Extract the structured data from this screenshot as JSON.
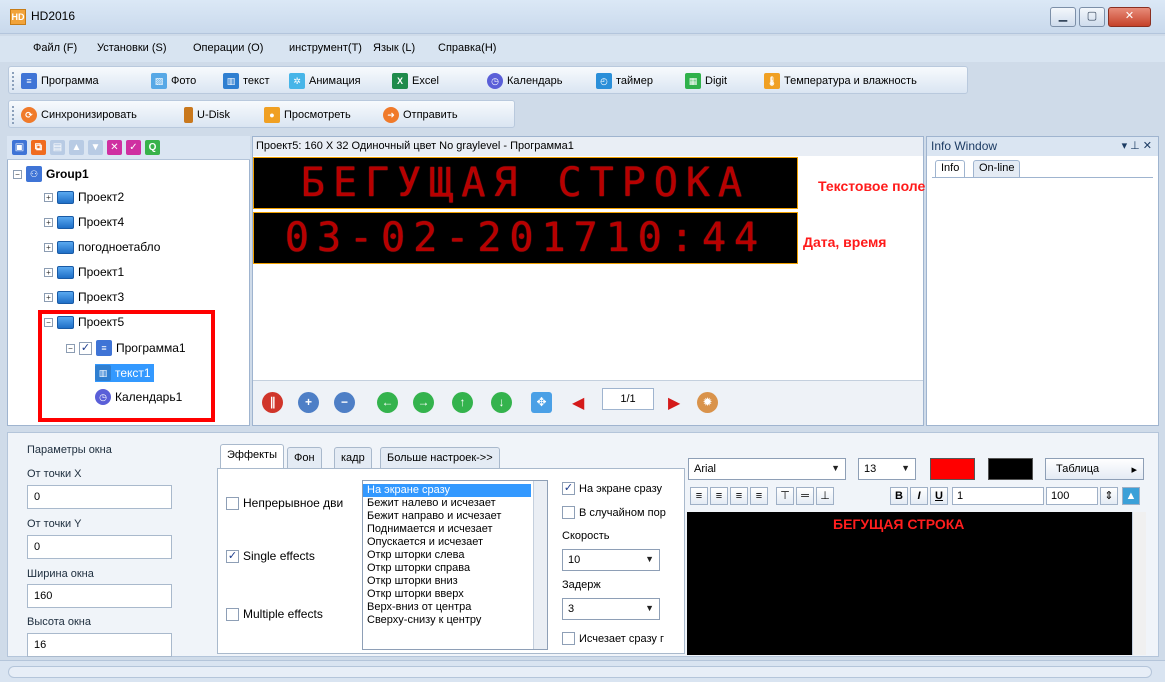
{
  "window": {
    "title": "HD2016",
    "app_icon": "HD"
  },
  "menu": [
    "Файл (F)",
    "Установки (S)",
    "Операции (O)",
    "инструмент(T)",
    "Язык (L)",
    "Справка(H)"
  ],
  "toolbar1": [
    "Программа",
    "Фото",
    "текст",
    "Анимация",
    "Excel",
    "Календарь",
    "таймер",
    "Digit",
    "Температура и влажность"
  ],
  "toolbar2": [
    "Синхронизировать",
    "U-Disk",
    "Просмотреть",
    "Отправить"
  ],
  "tree": {
    "group": "Group1",
    "projects": [
      "Проект2",
      "Проект4",
      "погодноетабло",
      "Проект1",
      "Проект3",
      "Проект5"
    ],
    "program": "Программа1",
    "text_item": "текст1",
    "calendar_item": "Календарь1"
  },
  "preview": {
    "header": "Проект5: 160 X 32  Одиночный цвет No graylevel - Программа1",
    "led_text": "БЕГУЩАЯ СТРОКА",
    "led_datetime": "03-02-201710:44",
    "label_text": "Текстовое поле",
    "label_datetime": "Дата, время",
    "page": "1/1"
  },
  "info_window": {
    "title": "Info Window",
    "tabs": [
      "Info",
      "On-line"
    ]
  },
  "params": {
    "title": "Параметры окна",
    "x_label": "От точки X",
    "x_value": "0",
    "y_label": "От точки Y",
    "y_value": "0",
    "w_label": "Ширина окна",
    "w_value": "160",
    "h_label": "Высота окна",
    "h_value": "16"
  },
  "tabs": [
    "Эффекты",
    "Фон",
    "кадр",
    "Больше настроек->>"
  ],
  "effects": {
    "continuous": "Непрерывное дви",
    "single": "Single effects",
    "multiple": "Multiple effects",
    "list": [
      "На экране сразу",
      "Бежит налево и исчезает",
      "Бежит направо и исчезает",
      "Поднимается и исчезает",
      "Опускается и исчезает",
      "Откр шторки слева",
      "Откр шторки справа",
      "Откр шторки вниз",
      "Откр шторки вверх",
      "Верх-вниз от центра",
      "Сверху-снизу к центру"
    ],
    "on_screen": "На экране сразу",
    "random": "В случайном пор",
    "speed_label": "Скорость",
    "speed_value": "10",
    "delay_label": "Задерж",
    "delay_value": "3",
    "fade": "Исчезает сразу г"
  },
  "editor": {
    "font": "Arial",
    "size": "13",
    "table": "Таблица",
    "spacing": "1",
    "scale": "100",
    "text": "БЕГУЩАЯ СТРОКА",
    "fg_color": "#ff0000",
    "bg_color": "#000000"
  }
}
